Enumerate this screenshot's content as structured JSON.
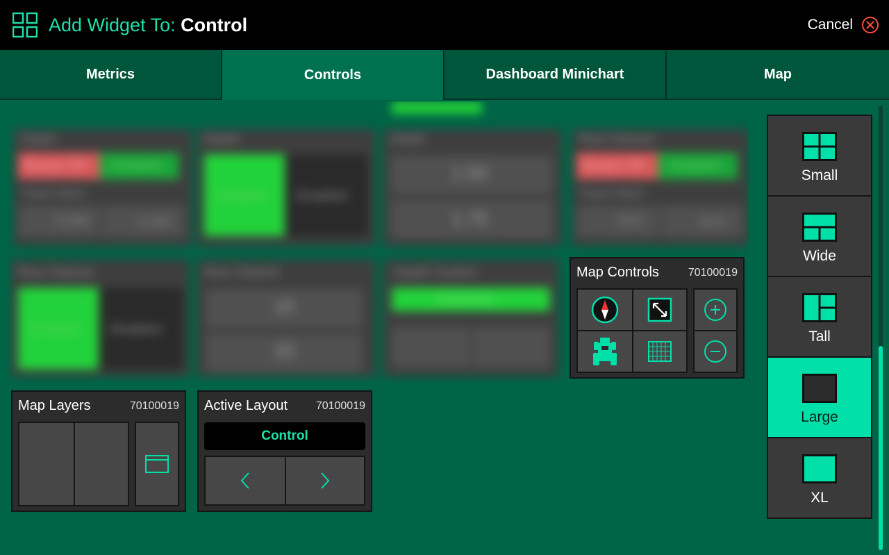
{
  "header": {
    "title_prefix": "Add Widget To: ",
    "title_target": "Control",
    "cancel_label": "Cancel",
    "icon": "grid-icon",
    "cancel_icon": "close-circle-icon",
    "accent_color": "#1fe0a8",
    "cancel_color": "#ff4b3a"
  },
  "tabs": [
    {
      "label": "Metrics",
      "active": false
    },
    {
      "label": "Controls",
      "active": true
    },
    {
      "label": "Dashboard Minichart",
      "active": false
    },
    {
      "label": "Map",
      "active": false
    }
  ],
  "background_widgets": {
    "depth_1": {
      "title": "Depth",
      "master": "Master Off",
      "enabled": "Enabled",
      "target_adjust": "Target Adjust",
      "value_left": "0.100",
      "value_right": "0.100"
    },
    "depth_2": {
      "title": "Depth",
      "enabled": "Enabled",
      "disabled": "Disabled"
    },
    "depth_3": {
      "title": "Depth",
      "value_top": "1.50",
      "value_bottom": "1.75"
    },
    "row_cleaner_1": {
      "title": "Row Cleaner",
      "master": "Master Off",
      "enabled": "Enabled",
      "target_adjust": "Target Adjust",
      "value_left": "10.0",
      "value_right": "10.0"
    },
    "row_cleaner_2": {
      "title": "Row Cleaner",
      "enabled": "Enabled",
      "disabled": "Disabled"
    },
    "row_cleaner_3": {
      "title": "Row Cleaner",
      "value_top": "10",
      "value_bottom": "20"
    },
    "swath_control": {
      "title": "Swath Control",
      "mode": "Automatic"
    }
  },
  "widgets": {
    "map_controls": {
      "title": "Map Controls",
      "id": "70100019",
      "icons": [
        "compass-icon",
        "expand-icon",
        "zoom-in-icon",
        "tractor-icon",
        "grid-map-icon",
        "zoom-out-icon"
      ]
    },
    "map_layers": {
      "title": "Map Layers",
      "id": "70100019",
      "icons": [
        "layer-window-icon"
      ]
    },
    "active_layout": {
      "title": "Active Layout",
      "id": "70100019",
      "value": "Control",
      "icons": [
        "chevron-left-icon",
        "chevron-right-icon"
      ]
    }
  },
  "sizes": {
    "items": [
      {
        "label": "Small",
        "icon": "size-small-icon",
        "selected": false
      },
      {
        "label": "Wide",
        "icon": "size-wide-icon",
        "selected": false
      },
      {
        "label": "Tall",
        "icon": "size-tall-icon",
        "selected": false
      },
      {
        "label": "Large",
        "icon": "size-large-icon",
        "selected": true
      },
      {
        "label": "XL",
        "icon": "size-xl-icon",
        "selected": false
      }
    ],
    "selected_color": "#00e0a8"
  }
}
